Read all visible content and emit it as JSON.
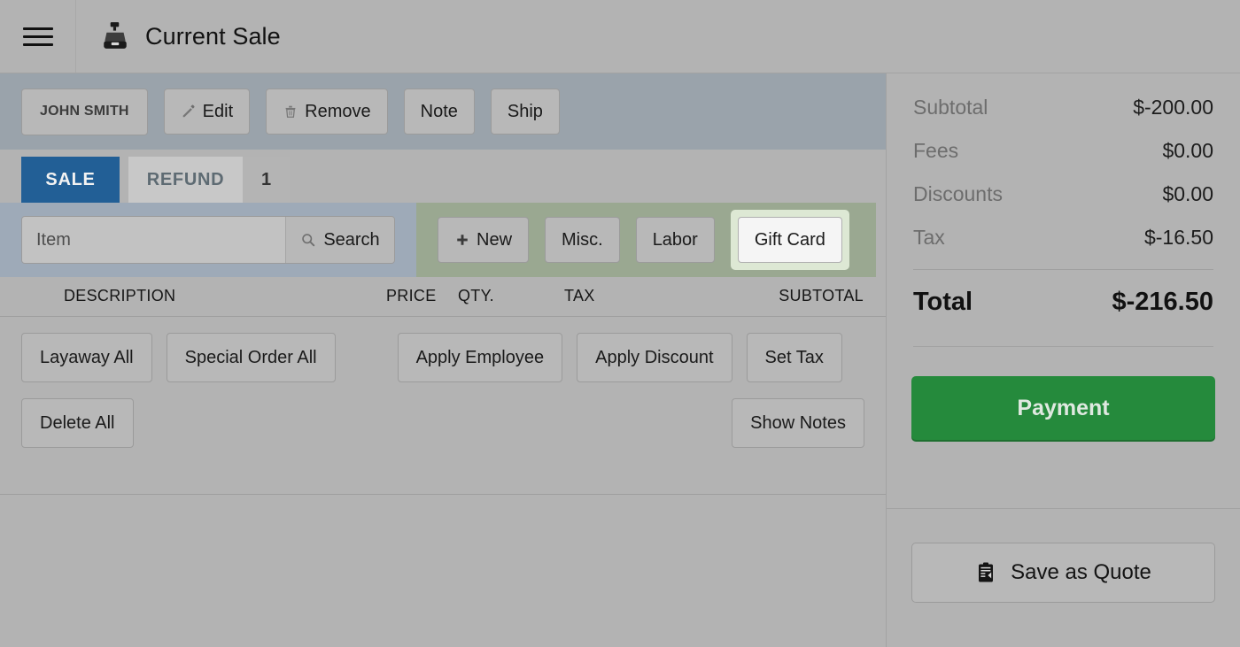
{
  "header": {
    "menu_icon": "hamburger-menu-icon",
    "app_icon": "cash-register-icon",
    "title": "Current Sale"
  },
  "toolbar": {
    "customer": "JOHN SMITH",
    "edit": "Edit",
    "edit_icon": "pencil-icon",
    "remove": "Remove",
    "remove_icon": "trash-icon",
    "note": "Note",
    "ship": "Ship"
  },
  "tabs": {
    "sale": "SALE",
    "refund": "REFUND",
    "refund_count": "1"
  },
  "search": {
    "placeholder": "Item",
    "value": "",
    "button": "Search",
    "icon": "magnifier-icon"
  },
  "quick_add": {
    "new": "New",
    "new_icon": "plus-icon",
    "misc": "Misc.",
    "labor": "Labor",
    "gift_card": "Gift Card"
  },
  "columns": {
    "description": "DESCRIPTION",
    "price": "PRICE",
    "qty": "QTY.",
    "tax": "TAX",
    "subtotal": "SUBTOTAL"
  },
  "actions": {
    "layaway_all": "Layaway All",
    "special_order_all": "Special Order All",
    "apply_employee": "Apply Employee",
    "apply_discount": "Apply Discount",
    "set_tax": "Set Tax",
    "delete_all": "Delete All",
    "show_notes": "Show Notes"
  },
  "totals": {
    "lines": [
      {
        "label": "Subtotal",
        "value": "$-200.00"
      },
      {
        "label": "Fees",
        "value": "$0.00"
      },
      {
        "label": "Discounts",
        "value": "$0.00"
      },
      {
        "label": "Tax",
        "value": "$-16.50"
      }
    ],
    "grand_label": "Total",
    "grand_value": "$-216.50"
  },
  "sidebar_actions": {
    "payment": "Payment",
    "save_as_quote": "Save as Quote",
    "quote_icon": "clipboard-save-icon"
  },
  "colors": {
    "page_bg": "#b3b3b3",
    "toolbar_bg": "#9aa3ab",
    "search_bg": "#9eaab8",
    "quick_panel_bg": "#9aa891",
    "sale_tab_blue": "#225f96",
    "payment_green": "#258a3c",
    "gift_highlight": "#dde8d4"
  }
}
